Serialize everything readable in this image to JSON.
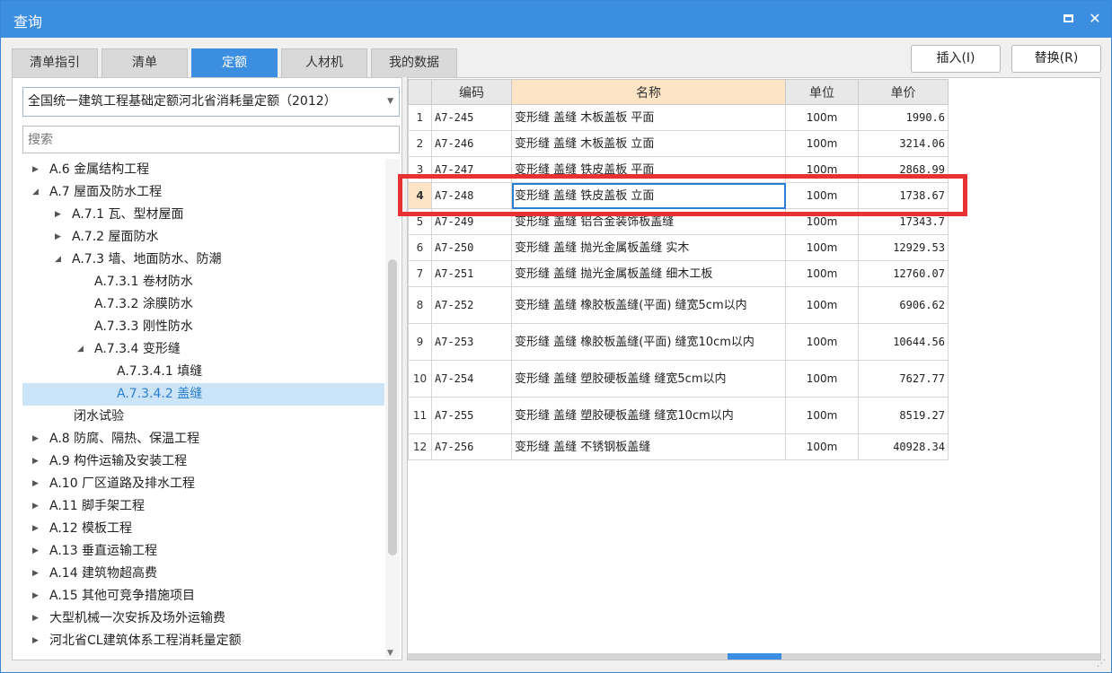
{
  "window": {
    "title": "查询",
    "maximize_icon": "maximize-icon",
    "close_icon": "close-icon",
    "close_glyph": "✕"
  },
  "tabs": [
    {
      "label": "清单指引",
      "active": false
    },
    {
      "label": "清单",
      "active": false
    },
    {
      "label": "定额",
      "active": true
    },
    {
      "label": "人材机",
      "active": false
    },
    {
      "label": "我的数据",
      "active": false
    }
  ],
  "actions": {
    "insert_label": "插入(I)",
    "replace_label": "替换(R)"
  },
  "library": {
    "selected": "全国统一建筑工程基础定额河北省消耗量定额（2012）"
  },
  "search": {
    "placeholder": "搜索"
  },
  "tree": [
    {
      "label": "A.6 金属结构工程",
      "arrow": "▶",
      "level": 0
    },
    {
      "label": "A.7 屋面及防水工程",
      "arrow": "◢",
      "level": 0
    },
    {
      "label": "A.7.1 瓦、型材屋面",
      "arrow": "▶",
      "level": 1
    },
    {
      "label": "A.7.2 屋面防水",
      "arrow": "▶",
      "level": 1
    },
    {
      "label": "A.7.3 墙、地面防水、防潮",
      "arrow": "◢",
      "level": 1
    },
    {
      "label": "A.7.3.1 卷材防水",
      "arrow": "",
      "level": 2
    },
    {
      "label": "A.7.3.2 涂膜防水",
      "arrow": "",
      "level": 2
    },
    {
      "label": "A.7.3.3 刚性防水",
      "arrow": "",
      "level": 2
    },
    {
      "label": "A.7.3.4 变形缝",
      "arrow": "◢",
      "level": 2
    },
    {
      "label": "A.7.3.4.1 填缝",
      "arrow": "",
      "level": 3
    },
    {
      "label": "A.7.3.4.2 盖缝",
      "arrow": "",
      "level": 3,
      "selected": true
    },
    {
      "label": "闭水试验",
      "arrow": "",
      "level": 1
    },
    {
      "label": "A.8 防腐、隔热、保温工程",
      "arrow": "▶",
      "level": 0
    },
    {
      "label": "A.9 构件运输及安装工程",
      "arrow": "▶",
      "level": 0
    },
    {
      "label": "A.10 厂区道路及排水工程",
      "arrow": "▶",
      "level": 0
    },
    {
      "label": "A.11 脚手架工程",
      "arrow": "▶",
      "level": 0
    },
    {
      "label": "A.12 模板工程",
      "arrow": "▶",
      "level": 0
    },
    {
      "label": "A.13 垂直运输工程",
      "arrow": "▶",
      "level": 0
    },
    {
      "label": "A.14 建筑物超高费",
      "arrow": "▶",
      "level": 0
    },
    {
      "label": "A.15 其他可竞争措施项目",
      "arrow": "▶",
      "level": 0
    },
    {
      "label": "大型机械一次安拆及场外运输费",
      "arrow": "▶",
      "level": 0
    },
    {
      "label": "河北省CL建筑体系工程消耗量定额",
      "arrow": "▶",
      "level": 0
    }
  ],
  "grid": {
    "headers": {
      "code": "编码",
      "name": "名称",
      "unit": "单位",
      "price": "单价"
    },
    "rows": [
      {
        "n": "1",
        "code": "A7-245",
        "name": "变形缝 盖缝 木板盖板 平面",
        "unit": "100m",
        "price": "1990.6"
      },
      {
        "n": "2",
        "code": "A7-246",
        "name": "变形缝 盖缝 木板盖板 立面",
        "unit": "100m",
        "price": "3214.06"
      },
      {
        "n": "3",
        "code": "A7-247",
        "name": "变形缝 盖缝 铁皮盖板 平面",
        "unit": "100m",
        "price": "2868.99"
      },
      {
        "n": "4",
        "code": "A7-248",
        "name": "变形缝 盖缝 铁皮盖板 立面",
        "unit": "100m",
        "price": "1738.67",
        "selected": true
      },
      {
        "n": "5",
        "code": "A7-249",
        "name": "变形缝 盖缝 铝合金装饰板盖缝",
        "unit": "100m",
        "price": "17343.7"
      },
      {
        "n": "6",
        "code": "A7-250",
        "name": "变形缝 盖缝 抛光金属板盖缝 实木",
        "unit": "100m",
        "price": "12929.53"
      },
      {
        "n": "7",
        "code": "A7-251",
        "name": "变形缝 盖缝 抛光金属板盖缝 细木工板",
        "unit": "100m",
        "price": "12760.07"
      },
      {
        "n": "8",
        "code": "A7-252",
        "name": "变形缝 盖缝 橡胶板盖缝(平面) 缝宽5cm以内",
        "unit": "100m",
        "price": "6906.62"
      },
      {
        "n": "9",
        "code": "A7-253",
        "name": "变形缝 盖缝 橡胶板盖缝(平面) 缝宽10cm以内",
        "unit": "100m",
        "price": "10644.56"
      },
      {
        "n": "10",
        "code": "A7-254",
        "name": "变形缝 盖缝 塑胶硬板盖缝 缝宽5cm以内",
        "unit": "100m",
        "price": "7627.77"
      },
      {
        "n": "11",
        "code": "A7-255",
        "name": "变形缝 盖缝 塑胶硬板盖缝 缝宽10cm以内",
        "unit": "100m",
        "price": "8519.27"
      },
      {
        "n": "12",
        "code": "A7-256",
        "name": "变形缝 盖缝 不锈钢板盖缝",
        "unit": "100m",
        "price": "40928.34"
      }
    ]
  },
  "colors": {
    "accent": "#3c8ee0",
    "highlight": "#e63232",
    "header_selected": "#fce4c4",
    "tree_selected": "#cce4f7"
  }
}
